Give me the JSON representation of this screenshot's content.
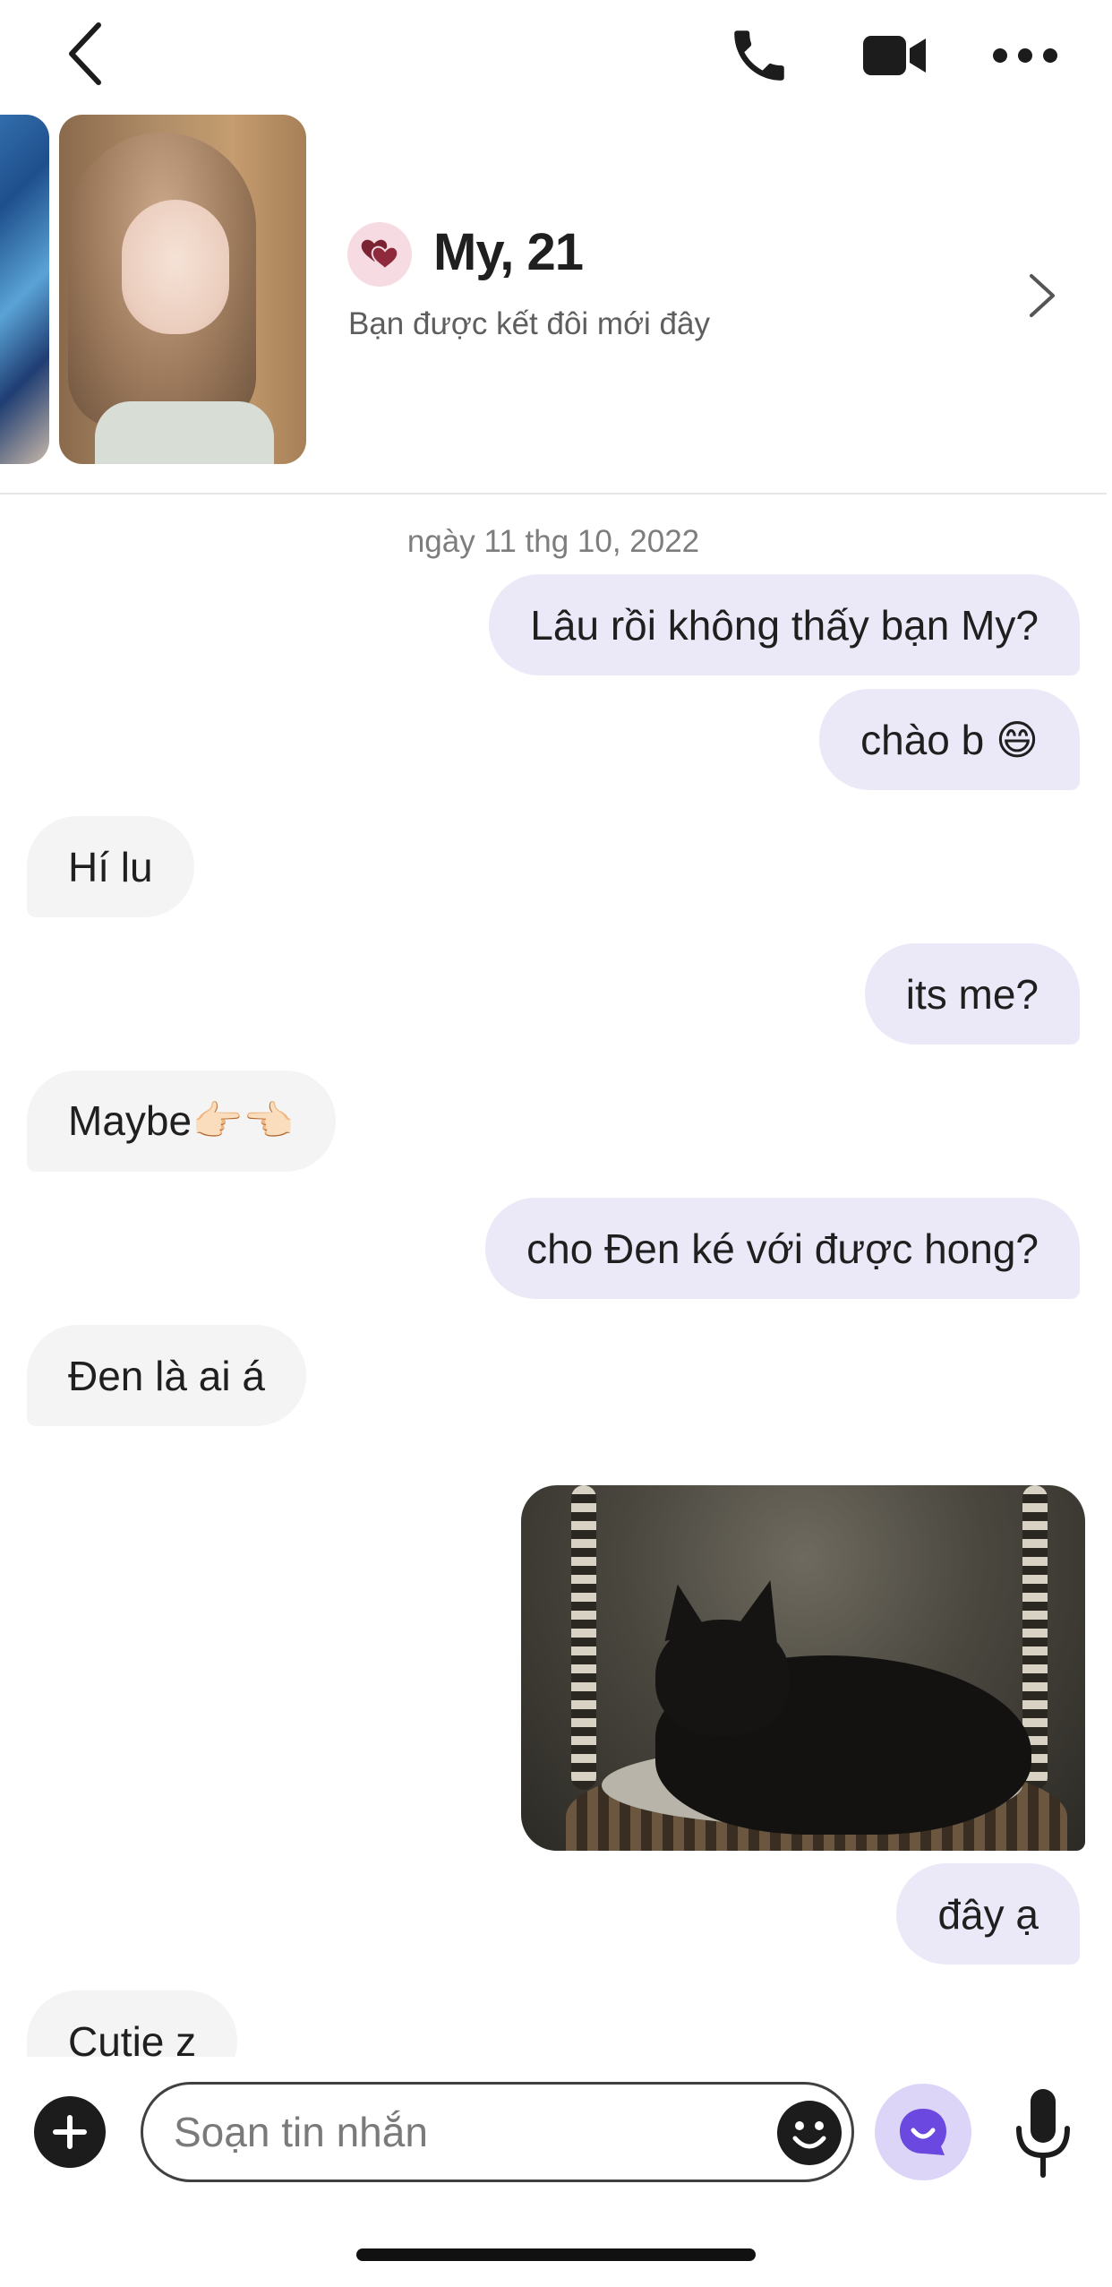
{
  "header": {
    "back_icon": "chevron-left-icon",
    "call_icon": "phone-icon",
    "video_icon": "video-camera-icon",
    "more_icon": "ellipsis-icon"
  },
  "profile": {
    "name": "My, 21",
    "subtitle": "Bạn được kết đôi mới đây",
    "match_icon": "double-heart-icon",
    "accent": "#7a2333"
  },
  "conversation": {
    "date": "ngày 11 thg 10, 2022",
    "messages": [
      {
        "from": "me",
        "text": "Lâu rồi không thấy bạn My?"
      },
      {
        "from": "me",
        "text": "chào b 😄"
      },
      {
        "from": "them",
        "text": "Hí lu"
      },
      {
        "from": "me",
        "text": "its me?"
      },
      {
        "from": "them",
        "text": "Maybe👉🏻👈🏻"
      },
      {
        "from": "me",
        "text": "cho Đen ké với được hong?"
      },
      {
        "from": "them",
        "text": "Đen là ai á"
      },
      {
        "from": "me",
        "type": "image",
        "image": "black-cat-photo"
      },
      {
        "from": "me",
        "text": "đây ạ"
      },
      {
        "from": "them",
        "text": "Cutie z"
      }
    ]
  },
  "composer": {
    "placeholder": "Soạn tin nhắn",
    "accent": "#6b49e0"
  }
}
